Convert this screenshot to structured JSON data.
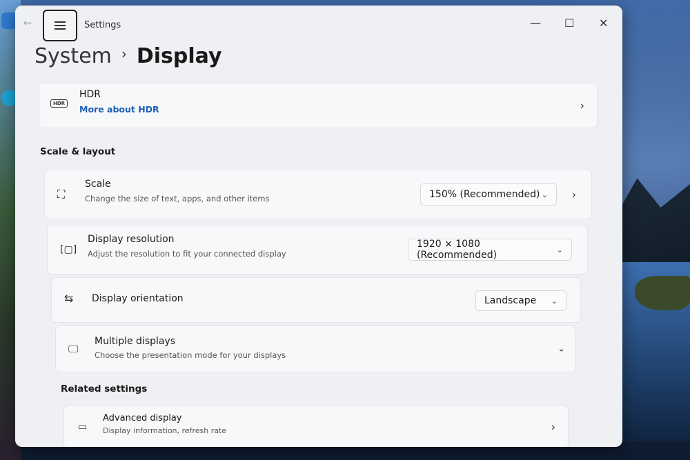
{
  "window": {
    "title": "Settings"
  },
  "breadcrumb": {
    "parent": "System",
    "separator": "›",
    "current": "Display"
  },
  "hdr": {
    "badge": "HDR",
    "title": "HDR",
    "link": "More about HDR"
  },
  "scale_layout": {
    "heading": "Scale & layout",
    "scale": {
      "title": "Scale",
      "subtitle": "Change the size of text, apps, and other items",
      "value": "150% (Recommended)"
    },
    "resolution": {
      "title": "Display resolution",
      "subtitle": "Adjust the resolution to fit your connected display",
      "value": "1920 × 1080 (Recommended)"
    },
    "orientation": {
      "title": "Display orientation",
      "value": "Landscape"
    },
    "multiple": {
      "title": "Multiple displays",
      "subtitle": "Choose the presentation mode for your displays"
    }
  },
  "related": {
    "heading": "Related settings",
    "advanced": {
      "title": "Advanced display",
      "subtitle": "Display information, refresh rate"
    }
  },
  "icons": {
    "back": "←",
    "chevron_right": "›",
    "chevron_down": "⌄",
    "minimize": "—",
    "maximize": "☐",
    "close": "✕",
    "scale": "⛶",
    "resolution": "[▢]",
    "orientation": "⇆",
    "multiple": "🖵",
    "advanced": "▭"
  }
}
